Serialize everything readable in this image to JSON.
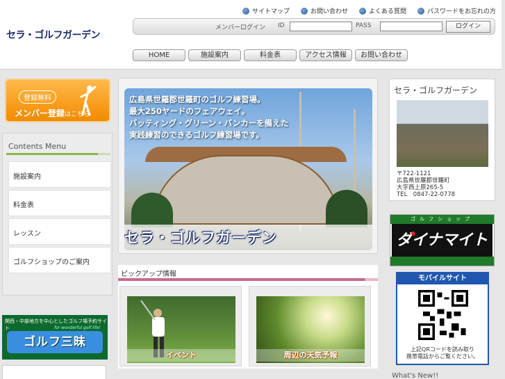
{
  "site": {
    "logo_text": "セラ・ゴルフガーデン"
  },
  "toplinks": [
    {
      "label": "サイトマップ",
      "icon": "circle-arrow-icon"
    },
    {
      "label": "お問い合わせ",
      "icon": "circle-arrow-icon"
    },
    {
      "label": "よくある質問",
      "icon": "circle-arrow-icon"
    },
    {
      "label": "パスワードをお忘れの方",
      "icon": "circle-arrow-icon"
    }
  ],
  "login": {
    "label": "メンバーログイン",
    "id_label": "ID",
    "pass_label": "PASS",
    "button_label": "ログイン"
  },
  "nav": {
    "tabs": [
      "HOME",
      "施設案内",
      "料金表",
      "アクセス情報",
      "お問い合わせ"
    ]
  },
  "member_banner": {
    "free_label": "登録無料",
    "register_label": "メンバー登録",
    "register_suffix": "はこちら"
  },
  "contents_menu": {
    "title": "Contents Menu",
    "items": [
      "施設案内",
      "料金表",
      "レッスン",
      "ゴルフショップのご案内"
    ]
  },
  "sanmai_banner": {
    "top": "関西・中部地方を中心としたゴルフ場予約サイト",
    "tagline": "for wonderful golf life!",
    "logo": "ゴルフ三昧"
  },
  "hero": {
    "copy_lines": [
      "広島県世羅郡世羅町のゴルフ練習場。",
      "最大250ヤードのフェアウェイ。",
      "バッティング・グリーン・バンカーを備えた",
      "実践練習のできるゴルフ練習場です。"
    ],
    "name": "セラ・ゴルフガーデン"
  },
  "pickup": {
    "title": "ピックアップ情報",
    "cards": [
      {
        "label": "イベント"
      },
      {
        "label": "周辺の天気予報"
      }
    ]
  },
  "info": {
    "name": "セラ・ゴルフガーデン",
    "postal": "〒722-1121",
    "address1": "広島県世羅郡世羅町",
    "address2": "大字西上原265-5",
    "tel": "TEL　0847-22-0778"
  },
  "shop_banner": {
    "top": "ゴルフショップ",
    "logo": "ダイナマイト"
  },
  "mobile": {
    "title": "モバイルサイト",
    "note_line1": "上記QRコードを読み取り",
    "note_line2": "携帯電話からご覧ください。"
  },
  "whats_new": {
    "title": "What's New!!"
  },
  "colors": {
    "logo_navy": "#1a2e6b",
    "member_orange": "#f28a00",
    "contents_green": "#8ab84b",
    "pickup_pink": "#c86a8a",
    "mobile_blue": "#1f57b0",
    "shop_green": "#1f7a2a"
  }
}
